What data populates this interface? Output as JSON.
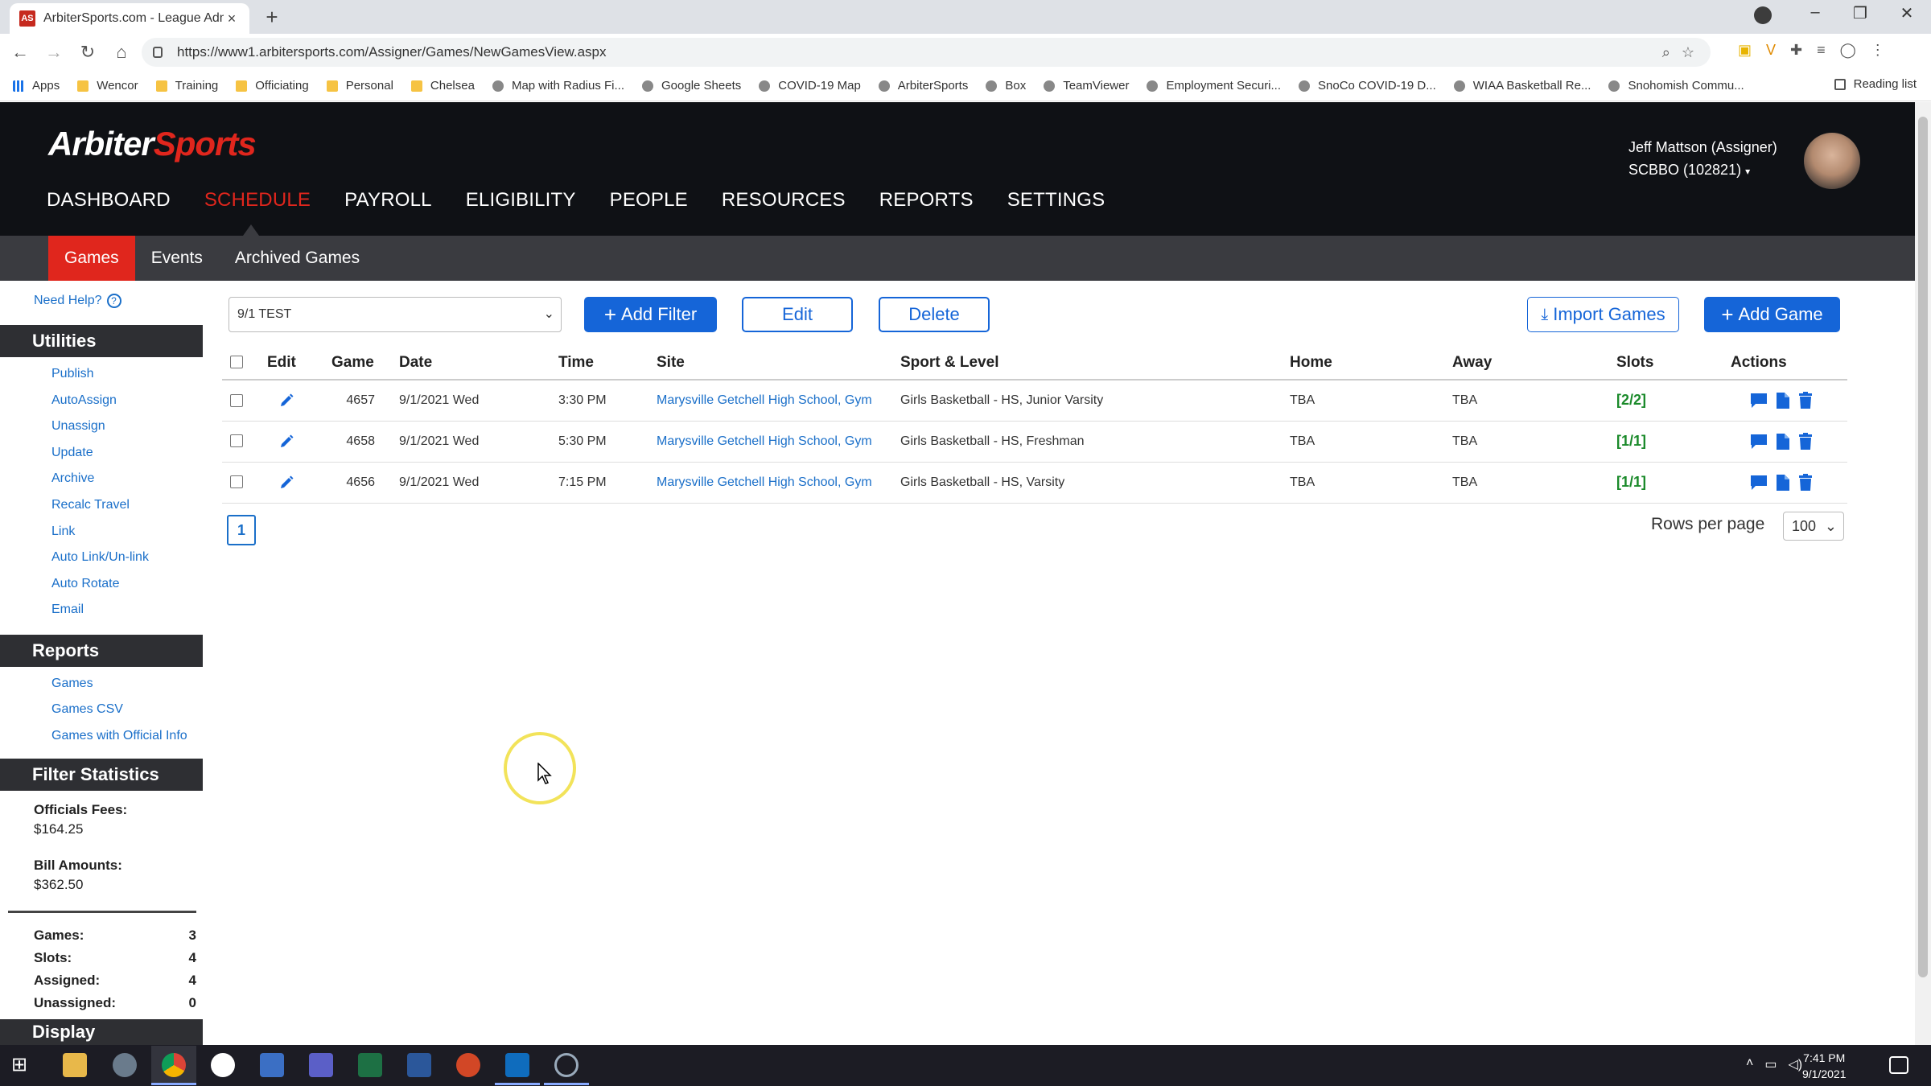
{
  "browser": {
    "tab_title": "ArbiterSports.com - League Adm",
    "favicon_text": "AS",
    "url": "https://www1.arbitersports.com/Assigner/Games/NewGamesView.aspx",
    "bookmarks": [
      {
        "label": "Apps",
        "icon": "apps-grid-icon"
      },
      {
        "label": "Wencor",
        "icon": "folder-icon"
      },
      {
        "label": "Training",
        "icon": "folder-icon"
      },
      {
        "label": "Officiating",
        "icon": "folder-icon"
      },
      {
        "label": "Personal",
        "icon": "folder-icon"
      },
      {
        "label": "Chelsea",
        "icon": "folder-icon"
      },
      {
        "label": "Map with Radius Fi...",
        "icon": "site-icon"
      },
      {
        "label": "Google Sheets",
        "icon": "site-icon"
      },
      {
        "label": "COVID-19 Map",
        "icon": "site-icon"
      },
      {
        "label": "ArbiterSports",
        "icon": "site-icon"
      },
      {
        "label": "Box",
        "icon": "site-icon"
      },
      {
        "label": "TeamViewer",
        "icon": "site-icon"
      },
      {
        "label": "Employment Securi...",
        "icon": "site-icon"
      },
      {
        "label": "SnoCo COVID-19 D...",
        "icon": "site-icon"
      },
      {
        "label": "WIAA Basketball Re...",
        "icon": "site-icon"
      },
      {
        "label": "Snohomish Commu...",
        "icon": "site-icon"
      }
    ],
    "reading_list": "Reading list"
  },
  "header": {
    "logo_part1": "Arbiter",
    "logo_part2": "Sports",
    "nav": [
      "DASHBOARD",
      "SCHEDULE",
      "PAYROLL",
      "ELIGIBILITY",
      "PEOPLE",
      "RESOURCES",
      "REPORTS",
      "SETTINGS"
    ],
    "active_nav": "SCHEDULE",
    "user_name": "Jeff Mattson (Assigner)",
    "user_org": "SCBBO (102821)",
    "subnav": [
      "Games",
      "Events",
      "Archived Games"
    ]
  },
  "sidebar": {
    "need_help": "Need Help?",
    "utilities_title": "Utilities",
    "utilities": [
      "Publish",
      "AutoAssign",
      "Unassign",
      "Update",
      "Archive",
      "Recalc Travel",
      "Link",
      "Auto Link/Un-link",
      "Auto Rotate",
      "Email"
    ],
    "reports_title": "Reports",
    "reports": [
      "Games",
      "Games CSV",
      "Games with Official Info"
    ],
    "filter_stats_title": "Filter Statistics",
    "officials_fees_label": "Officials Fees:",
    "officials_fees_value": "$164.25",
    "bill_amounts_label": "Bill Amounts:",
    "bill_amounts_value": "$362.50",
    "counts": [
      {
        "label": "Games:",
        "value": "3"
      },
      {
        "label": "Slots:",
        "value": "4"
      },
      {
        "label": "Assigned:",
        "value": "4"
      },
      {
        "label": "Unassigned:",
        "value": "0"
      }
    ],
    "display_title": "Display"
  },
  "toolbar": {
    "filter_value": "9/1 TEST",
    "add_filter": "Add Filter",
    "edit": "Edit",
    "delete": "Delete",
    "import_games": "Import Games",
    "add_game": "Add Game"
  },
  "table": {
    "columns": [
      "Edit",
      "Game",
      "Date",
      "Time",
      "Site",
      "Sport & Level",
      "Home",
      "Away",
      "Slots",
      "Actions"
    ],
    "rows": [
      {
        "game": "4657",
        "date": "9/1/2021 Wed",
        "time": "3:30 PM",
        "site": "Marysville Getchell High School, Gym",
        "sport": "Girls Basketball - HS, Junior Varsity",
        "home": "TBA",
        "away": "TBA",
        "slots": "[2/2]"
      },
      {
        "game": "4658",
        "date": "9/1/2021 Wed",
        "time": "5:30 PM",
        "site": "Marysville Getchell High School, Gym",
        "sport": "Girls Basketball - HS, Freshman",
        "home": "TBA",
        "away": "TBA",
        "slots": "[1/1]"
      },
      {
        "game": "4656",
        "date": "9/1/2021 Wed",
        "time": "7:15 PM",
        "site": "Marysville Getchell High School, Gym",
        "sport": "Girls Basketball - HS, Varsity",
        "home": "TBA",
        "away": "TBA",
        "slots": "[1/1]"
      }
    ]
  },
  "pagination": {
    "current_page": "1",
    "rows_per_page_label": "Rows per page",
    "rows_per_page_value": "100"
  },
  "taskbar": {
    "time": "7:41 PM",
    "date": "9/1/2021"
  },
  "colors": {
    "brand_red": "#e0261d",
    "primary_blue": "#1565d8",
    "header_bg": "#0f1115",
    "slots_green": "#1a8a2a"
  }
}
